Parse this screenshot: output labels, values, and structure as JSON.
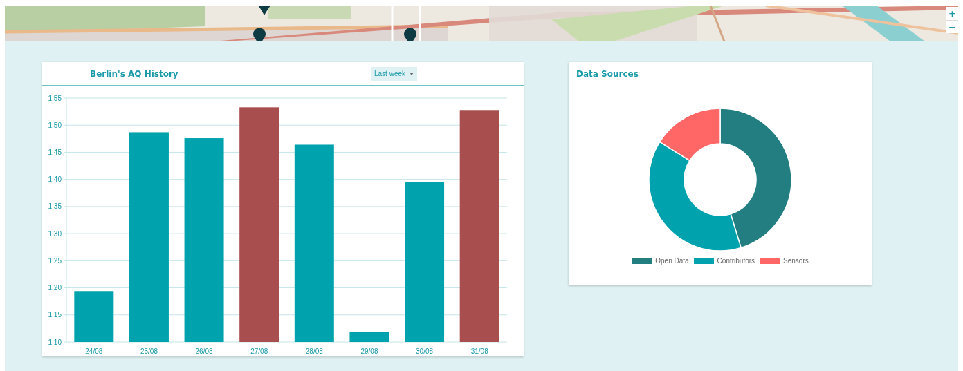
{
  "map": {
    "zoom_in": "+",
    "zoom_out": "−"
  },
  "history_card": {
    "title": "Berlin's AQ History",
    "period": "Last week",
    "chart_data": {
      "type": "bar",
      "categories": [
        "24/08",
        "25/08",
        "26/08",
        "27/08",
        "28/08",
        "29/08",
        "30/08",
        "31/08"
      ],
      "grid": true,
      "stacked": true,
      "series": [
        {
          "color": "#00a3ad",
          "values": [
            1.194,
            1.487,
            1.476,
            null,
            1.464,
            1.119,
            1.395,
            null
          ]
        },
        {
          "color": "#a84e4e",
          "values": [
            null,
            null,
            null,
            1.533,
            null,
            null,
            null,
            1.528
          ]
        }
      ],
      "ylim": [
        1.1,
        1.55
      ],
      "yticks": [
        {
          "value": 1.1,
          "label": "1.10"
        },
        {
          "value": 1.15,
          "label": "1.15"
        },
        {
          "value": 1.2,
          "label": "1.20"
        },
        {
          "value": 1.25,
          "label": "1.25"
        },
        {
          "value": 1.3,
          "label": "1.30"
        },
        {
          "value": 1.35,
          "label": "1.35"
        },
        {
          "value": 1.4,
          "label": "1.40"
        },
        {
          "value": 1.45,
          "label": "1.45"
        },
        {
          "value": 1.5,
          "label": "1.50"
        },
        {
          "value": 1.55,
          "label": "1.55"
        }
      ]
    }
  },
  "sources_card": {
    "title": "Data Sources",
    "legend": [
      {
        "label": "Open Data",
        "color": "#237e82"
      },
      {
        "label": "Contributors",
        "color": "#00a3ad"
      },
      {
        "label": "Sensors",
        "color": "#ff6666"
      }
    ]
  }
}
